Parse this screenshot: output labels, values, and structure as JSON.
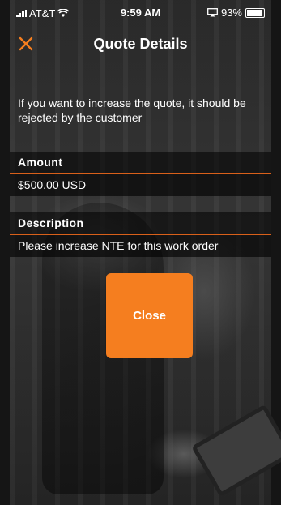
{
  "status_bar": {
    "carrier": "AT&T",
    "time": "9:59 AM",
    "battery": "93%"
  },
  "nav": {
    "title": "Quote Details",
    "close_icon": "close-x-icon"
  },
  "info_text": "If you want to increase the quote, it should be rejected by the customer",
  "amount": {
    "label": "Amount",
    "value": "$500.00 USD"
  },
  "description": {
    "label": "Description",
    "value": "Please increase NTE for this work order"
  },
  "close_button": {
    "label": "Close"
  },
  "colors": {
    "accent": "#f57e1f"
  }
}
